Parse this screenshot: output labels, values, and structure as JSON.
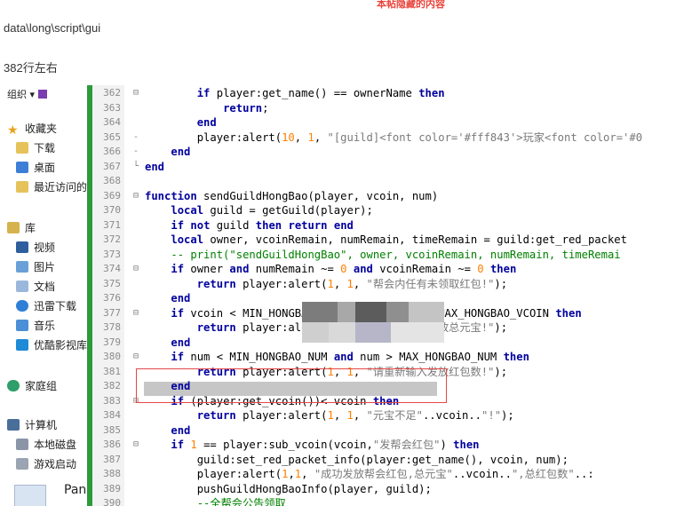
{
  "post": {
    "hidden_note": "本帖隐藏的内容",
    "path": "data\\long\\script\\gui",
    "line_note": "382行左右"
  },
  "explorer": {
    "org_label": "组织 ▾",
    "items": [
      {
        "label": "收藏夹",
        "icon": "star-icon"
      },
      {
        "label": "下载",
        "icon": "download-folder-icon"
      },
      {
        "label": "桌面",
        "icon": "desktop-icon"
      },
      {
        "label": "最近访问的",
        "icon": "recent-places-icon"
      },
      {
        "label": "库",
        "icon": "library-icon"
      },
      {
        "label": "视频",
        "icon": "video-icon"
      },
      {
        "label": "图片",
        "icon": "picture-icon"
      },
      {
        "label": "文档",
        "icon": "document-icon"
      },
      {
        "label": "迅雷下载",
        "icon": "thunder-download-icon"
      },
      {
        "label": "音乐",
        "icon": "music-icon"
      },
      {
        "label": "优酷影视库",
        "icon": "youku-icon"
      },
      {
        "label": "家庭组",
        "icon": "homegroup-icon"
      },
      {
        "label": "计算机",
        "icon": "computer-icon"
      },
      {
        "label": "本地磁盘",
        "icon": "local-disk-icon"
      },
      {
        "label": "游戏启动",
        "icon": "game-launch-icon"
      }
    ],
    "pan_label": "Pan"
  },
  "editor": {
    "highlighted_line": "382",
    "lines": [
      {
        "n": "362",
        "text": "        if player:get_name() == ownerName then"
      },
      {
        "n": "363",
        "text": "            return;"
      },
      {
        "n": "364",
        "text": "        end"
      },
      {
        "n": "365",
        "text": "        player:alert(10, 1, \"[guild]<font color='#fff843'>玩家<font color='#0"
      },
      {
        "n": "366",
        "text": "    end"
      },
      {
        "n": "367",
        "text": "end"
      },
      {
        "n": "368",
        "text": ""
      },
      {
        "n": "369",
        "text": "function sendGuildHongBao(player, vcoin, num)"
      },
      {
        "n": "370",
        "text": "    local guild = getGuild(player);"
      },
      {
        "n": "371",
        "text": "    if not guild then return end"
      },
      {
        "n": "372",
        "text": "    local owner, vcoinRemain, numRemain, timeRemain = guild:get_red_packet"
      },
      {
        "n": "373",
        "text": "    -- print(\"sendGuildHongBao\", owner, vcoinRemain, numRemain, timeRemai"
      },
      {
        "n": "374",
        "text": "    if owner and numRemain ~= 0 and vcoinRemain ~= 0 then"
      },
      {
        "n": "375",
        "text": "        return player:alert(1, 1, \"帮会内任有未领取红包!\");"
      },
      {
        "n": "376",
        "text": "    end"
      },
      {
        "n": "377",
        "text": "    if vcoin < MIN_HONGBAO_VCOIN and vcoin > MAX_HONGBAO_VCOIN then"
      },
      {
        "n": "378",
        "text": "        return player:alert(1, 1, \"请重新输入发放总元宝!\");"
      },
      {
        "n": "379",
        "text": "    end"
      },
      {
        "n": "380",
        "text": "    if num < MIN_HONGBAO_NUM and num > MAX_HONGBAO_NUM then"
      },
      {
        "n": "381",
        "text": "        return player:alert(1, 1, \"请重新输入发放红包数!\");"
      },
      {
        "n": "382",
        "text": "    end"
      },
      {
        "n": "383",
        "text": "    if (player:get_vcoin())< vcoin then"
      },
      {
        "n": "384",
        "text": "        return player:alert(1, 1, \"元宝不足\"..vcoin..\"!\");"
      },
      {
        "n": "385",
        "text": "    end"
      },
      {
        "n": "386",
        "text": "    if 1 == player:sub_vcoin(vcoin,\"发帮会红包\") then"
      },
      {
        "n": "387",
        "text": "        guild:set_red_packet_info(player:get_name(), vcoin, num);"
      },
      {
        "n": "388",
        "text": "        player:alert(1,1, \"成功发放帮会红包,总元宝\"..vcoin..\",总红包数\"..:"
      },
      {
        "n": "389",
        "text": "        pushGuildHongBaoInfo(player, guild);"
      },
      {
        "n": "390",
        "text": "        --全帮会公告领取"
      },
      {
        "n": "391",
        "text": "        -- server.info(10,0,\"[system]恭喜<font color='#01ebff'>\"..player:"
      }
    ]
  },
  "colors": {
    "keyword": "#00009e",
    "number": "#ff7f00",
    "string": "#7a7a7a",
    "comment": "#008000",
    "highlight_box": "#e54646",
    "gutter_edge": "#2c9b3a"
  }
}
